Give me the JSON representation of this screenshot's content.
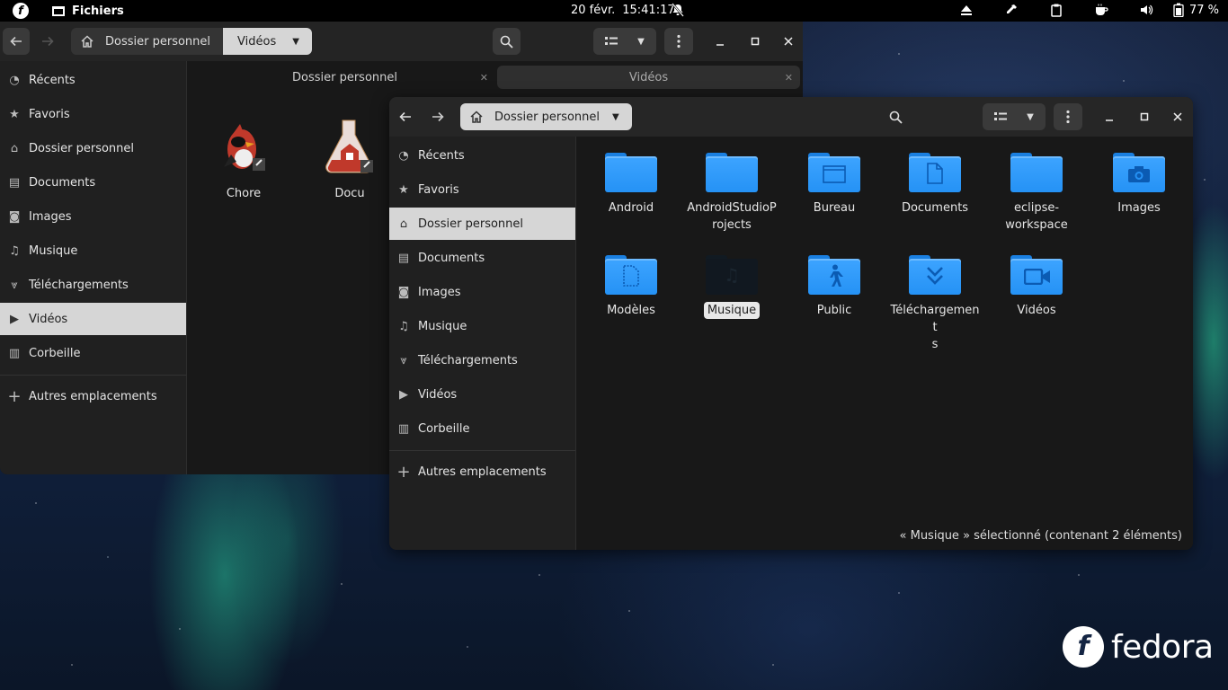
{
  "topbar": {
    "app_name": "Fichiers",
    "date": "20 févr.",
    "time": "15:41:17",
    "battery": "77 %",
    "icons": [
      "fedora-icon",
      "bell-off-icon",
      "eject-icon",
      "color-picker-icon",
      "clipboard-icon",
      "coffee-icon",
      "volume-icon",
      "battery-icon"
    ]
  },
  "window_back": {
    "breadcrumb": [
      "Dossier personnel",
      "Vidéos"
    ],
    "sidebar": [
      "Récents",
      "Favoris",
      "Dossier personnel",
      "Documents",
      "Images",
      "Musique",
      "Téléchargements",
      "Vidéos",
      "Corbeille"
    ],
    "other_locations": "Autres emplacements",
    "selected": "Vidéos",
    "tabs": [
      "Dossier personnel",
      "Vidéos"
    ],
    "files": [
      "Chore",
      "Docu"
    ]
  },
  "window_front": {
    "breadcrumb": "Dossier personnel",
    "sidebar": [
      "Récents",
      "Favoris",
      "Dossier personnel",
      "Documents",
      "Images",
      "Musique",
      "Téléchargements",
      "Vidéos",
      "Corbeille"
    ],
    "other_locations": "Autres emplacements",
    "selected": "Dossier personnel",
    "folders": [
      "Android",
      "AndroidStudioProjects",
      "Bureau",
      "Documents",
      "eclipse-workspace",
      "Images",
      "Modèles",
      "Musique",
      "Public",
      "Téléchargements",
      "Vidéos"
    ],
    "folder_label_lines": {
      "androidstudio": [
        "AndroidStudioP",
        "rojects"
      ],
      "eclipse": [
        "eclipse-",
        "workspace"
      ],
      "telechargements": [
        "Téléchargement",
        "s"
      ]
    },
    "status": "« Musique » sélectionné  (contenant 2 éléments)"
  },
  "wallpaper": {
    "brand": "fedora"
  },
  "colors": {
    "folder": "#2592f5",
    "topbar": "#000000",
    "selection": "#d6d6d6"
  }
}
